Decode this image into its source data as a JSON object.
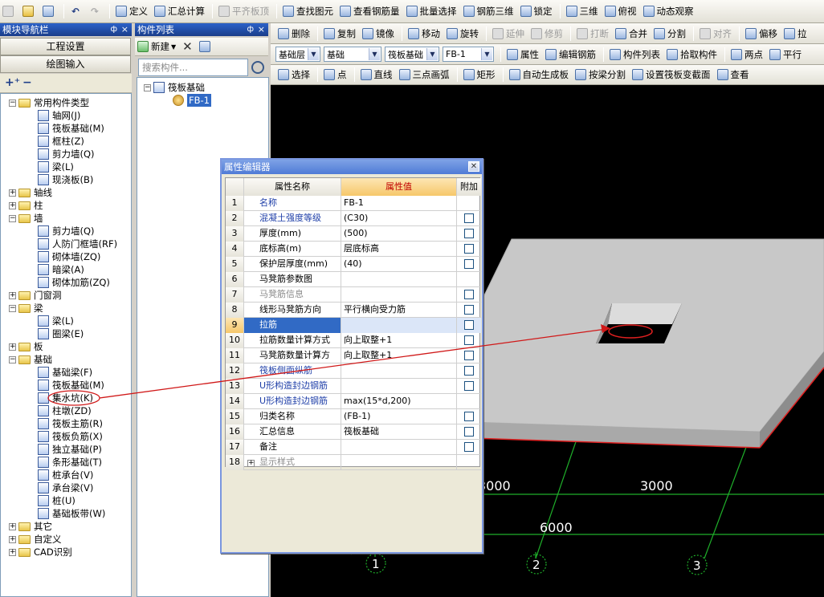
{
  "main_toolbar": {
    "items": [
      {
        "label": "定义",
        "icon": "define-icon"
      },
      {
        "label": "汇总计算",
        "icon": "sigma-icon"
      },
      {
        "label": "平齐板顶",
        "icon": "align-top-icon",
        "disabled": true
      },
      {
        "label": "查找图元",
        "icon": "binoculars-icon"
      },
      {
        "label": "查看钢筋量",
        "icon": "rebar-qty-icon"
      },
      {
        "label": "批量选择",
        "icon": "batch-select-icon"
      },
      {
        "label": "钢筋三维",
        "icon": "rebar-3d-icon"
      },
      {
        "label": "锁定",
        "icon": "lock-icon"
      },
      {
        "label": "三维",
        "icon": "3d-icon"
      },
      {
        "label": "俯视",
        "icon": "top-view-icon"
      },
      {
        "label": "动态观察",
        "icon": "orbit-icon"
      }
    ]
  },
  "nav_panel": {
    "title": "模块导航栏",
    "buttons": [
      "工程设置",
      "绘图输入"
    ],
    "tree": [
      {
        "label": "常用构件类型",
        "type": "folder",
        "exp": "-",
        "level": 0
      },
      {
        "label": "轴网(J)",
        "type": "leaf",
        "level": 1
      },
      {
        "label": "筏板基础(M)",
        "type": "leaf",
        "level": 1
      },
      {
        "label": "框柱(Z)",
        "type": "leaf",
        "level": 1
      },
      {
        "label": "剪力墙(Q)",
        "type": "leaf",
        "level": 1
      },
      {
        "label": "梁(L)",
        "type": "leaf",
        "level": 1
      },
      {
        "label": "现浇板(B)",
        "type": "leaf",
        "level": 1
      },
      {
        "label": "轴线",
        "type": "folder",
        "exp": "+",
        "level": 0
      },
      {
        "label": "柱",
        "type": "folder",
        "exp": "+",
        "level": 0
      },
      {
        "label": "墙",
        "type": "folder",
        "exp": "-",
        "level": 0
      },
      {
        "label": "剪力墙(Q)",
        "type": "leaf",
        "level": 1
      },
      {
        "label": "人防门框墙(RF)",
        "type": "leaf",
        "level": 1
      },
      {
        "label": "砌体墙(ZQ)",
        "type": "leaf",
        "level": 1
      },
      {
        "label": "暗梁(A)",
        "type": "leaf",
        "level": 1
      },
      {
        "label": "砌体加筋(ZQ)",
        "type": "leaf",
        "level": 1
      },
      {
        "label": "门窗洞",
        "type": "folder",
        "exp": "+",
        "level": 0
      },
      {
        "label": "梁",
        "type": "folder",
        "exp": "-",
        "level": 0
      },
      {
        "label": "梁(L)",
        "type": "leaf",
        "level": 1
      },
      {
        "label": "圈梁(E)",
        "type": "leaf",
        "level": 1
      },
      {
        "label": "板",
        "type": "folder",
        "exp": "+",
        "level": 0
      },
      {
        "label": "基础",
        "type": "folder",
        "exp": "-",
        "level": 0
      },
      {
        "label": "基础梁(F)",
        "type": "leaf",
        "level": 1
      },
      {
        "label": "筏板基础(M)",
        "type": "leaf",
        "level": 1
      },
      {
        "label": "集水坑(K)",
        "type": "leaf",
        "level": 1
      },
      {
        "label": "柱墩(ZD)",
        "type": "leaf",
        "level": 1
      },
      {
        "label": "筏板主筋(R)",
        "type": "leaf",
        "level": 1
      },
      {
        "label": "筏板负筋(X)",
        "type": "leaf",
        "level": 1
      },
      {
        "label": "独立基础(P)",
        "type": "leaf",
        "level": 1
      },
      {
        "label": "条形基础(T)",
        "type": "leaf",
        "level": 1
      },
      {
        "label": "桩承台(V)",
        "type": "leaf",
        "level": 1
      },
      {
        "label": "承台梁(V)",
        "type": "leaf",
        "level": 1
      },
      {
        "label": "桩(U)",
        "type": "leaf",
        "level": 1
      },
      {
        "label": "基础板带(W)",
        "type": "leaf",
        "level": 1
      },
      {
        "label": "其它",
        "type": "folder",
        "exp": "+",
        "level": 0
      },
      {
        "label": "自定义",
        "type": "folder",
        "exp": "+",
        "level": 0
      },
      {
        "label": "CAD识别",
        "type": "folder",
        "exp": "+",
        "level": 0
      }
    ]
  },
  "component_panel": {
    "title": "构件列表",
    "new_label": "新建",
    "search_placeholder": "搜索构件...",
    "tree_root": "筏板基础",
    "tree_child": "FB-1"
  },
  "edit_toolbar": {
    "items": [
      {
        "label": "删除",
        "icon": "delete-icon"
      },
      {
        "label": "复制",
        "icon": "copy-icon"
      },
      {
        "label": "镜像",
        "icon": "mirror-icon"
      },
      {
        "label": "移动",
        "icon": "move-icon"
      },
      {
        "label": "旋转",
        "icon": "rotate-icon"
      },
      {
        "label": "延伸",
        "icon": "extend-icon",
        "disabled": true
      },
      {
        "label": "修剪",
        "icon": "trim-icon",
        "disabled": true
      },
      {
        "label": "打断",
        "icon": "break-icon",
        "disabled": true
      },
      {
        "label": "合并",
        "icon": "merge-icon"
      },
      {
        "label": "分割",
        "icon": "split-icon"
      },
      {
        "label": "对齐",
        "icon": "align-icon",
        "disabled": true
      },
      {
        "label": "偏移",
        "icon": "offset-icon"
      },
      {
        "label": "拉",
        "icon": "stretch-icon"
      }
    ]
  },
  "layer_toolbar": {
    "combos": [
      "基础层",
      "基础",
      "筏板基础",
      "FB-1"
    ],
    "items": [
      {
        "label": "属性",
        "icon": "properties-icon"
      },
      {
        "label": "编辑钢筋",
        "icon": "edit-rebar-icon"
      },
      {
        "label": "构件列表",
        "icon": "component-list-icon"
      },
      {
        "label": "拾取构件",
        "icon": "pick-icon"
      },
      {
        "label": "两点",
        "icon": "two-point-icon"
      },
      {
        "label": "平行",
        "icon": "parallel-icon"
      }
    ]
  },
  "draw_toolbar": {
    "items": [
      {
        "label": "选择",
        "icon": "cursor-icon"
      },
      {
        "label": "点",
        "icon": "point-icon"
      },
      {
        "label": "直线",
        "icon": "line-icon"
      },
      {
        "label": "三点画弧",
        "icon": "arc-icon"
      },
      {
        "label": "矩形",
        "icon": "rectangle-icon"
      },
      {
        "label": "自动生成板",
        "icon": "auto-slab-icon"
      },
      {
        "label": "按梁分割",
        "icon": "split-by-beam-icon"
      },
      {
        "label": "设置筏板变截面",
        "icon": "variable-section-icon"
      },
      {
        "label": "查看",
        "icon": "view-icon"
      }
    ]
  },
  "property_editor": {
    "title": "属性编辑器",
    "headers": {
      "name": "属性名称",
      "value": "属性值",
      "extra": "附加"
    },
    "rows": [
      {
        "num": "1",
        "name": "名称",
        "value": "FB-1",
        "style": "blue",
        "checkbox": false
      },
      {
        "num": "2",
        "name": "混凝土强度等级",
        "value": "(C30)",
        "style": "blue",
        "checkbox": true
      },
      {
        "num": "3",
        "name": "厚度(mm)",
        "value": "(500)",
        "style": "black",
        "checkbox": true
      },
      {
        "num": "4",
        "name": "底标高(m)",
        "value": "层底标高",
        "style": "black",
        "checkbox": true
      },
      {
        "num": "5",
        "name": "保护层厚度(mm)",
        "value": "(40)",
        "style": "black",
        "checkbox": true
      },
      {
        "num": "6",
        "name": "马凳筋参数图",
        "value": "",
        "style": "black",
        "checkbox": false
      },
      {
        "num": "7",
        "name": "马凳筋信息",
        "value": "",
        "style": "gray",
        "checkbox": true
      },
      {
        "num": "8",
        "name": "线形马凳筋方向",
        "value": "平行横向受力筋",
        "style": "black",
        "checkbox": true
      },
      {
        "num": "9",
        "name": "拉筋",
        "value": "",
        "style": "selected",
        "checkbox": true
      },
      {
        "num": "10",
        "name": "拉筋数量计算方式",
        "value": "向上取整+1",
        "style": "black",
        "checkbox": true
      },
      {
        "num": "11",
        "name": "马凳筋数量计算方",
        "value": "向上取整+1",
        "style": "black",
        "checkbox": true
      },
      {
        "num": "12",
        "name": "筏板侧面纵筋",
        "value": "",
        "style": "blue",
        "checkbox": true
      },
      {
        "num": "13",
        "name": "U形构造封边钢筋",
        "value": "",
        "style": "blue",
        "checkbox": true
      },
      {
        "num": "14",
        "name": "U形构造封边钢筋",
        "value": "max(15*d,200)",
        "style": "blue",
        "checkbox": false
      },
      {
        "num": "15",
        "name": "归类名称",
        "value": "(FB-1)",
        "style": "black",
        "checkbox": true
      },
      {
        "num": "16",
        "name": "汇总信息",
        "value": "筏板基础",
        "style": "black",
        "checkbox": true
      },
      {
        "num": "17",
        "name": "备注",
        "value": "",
        "style": "black",
        "checkbox": true
      },
      {
        "num": "18",
        "name": "显示样式",
        "value": "",
        "style": "gray",
        "checkbox": false,
        "expander": "+"
      }
    ]
  },
  "viewport": {
    "dimensions": [
      "3000",
      "3000",
      "6000"
    ],
    "axis_labels": [
      "1",
      "2",
      "3"
    ],
    "colors": {
      "slab": "#c8c8c8",
      "grid": "#1fae2a",
      "annotation": "#d01818",
      "axis_circle": "#1fae2a"
    }
  }
}
